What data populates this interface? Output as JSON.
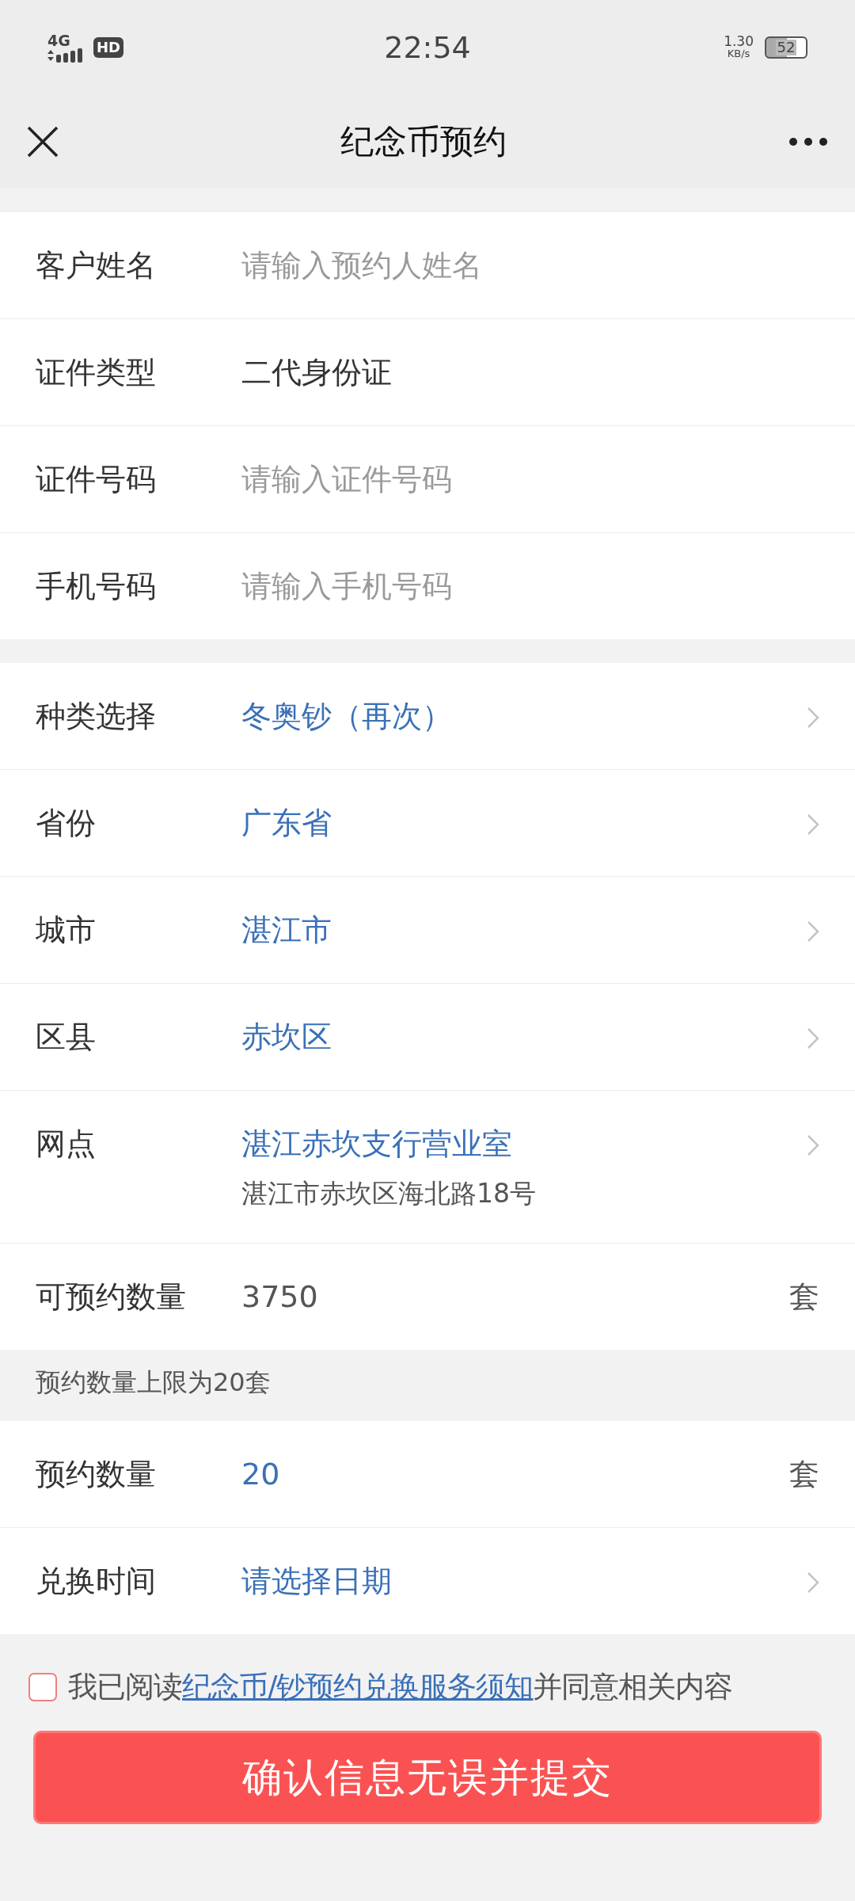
{
  "status_bar": {
    "network": "4G",
    "hd": "HD",
    "time": "22:54",
    "speed": "1.30",
    "speed_unit": "KB/s",
    "battery": "52"
  },
  "nav": {
    "title": "纪念币预约"
  },
  "sections": [
    {
      "rows": [
        {
          "kind": "input",
          "label": "客户姓名",
          "placeholder": "请输入预约人姓名"
        },
        {
          "kind": "text",
          "label": "证件类型",
          "value": "二代身份证"
        },
        {
          "kind": "input",
          "label": "证件号码",
          "placeholder": "请输入证件号码"
        },
        {
          "kind": "input",
          "label": "手机号码",
          "placeholder": "请输入手机号码"
        }
      ]
    },
    {
      "rows": [
        {
          "kind": "select",
          "label": "种类选择",
          "value": "冬奥钞（再次）"
        },
        {
          "kind": "select",
          "label": "省份",
          "value": "广东省"
        },
        {
          "kind": "select",
          "label": "城市",
          "value": "湛江市"
        },
        {
          "kind": "select",
          "label": "区县",
          "value": "赤坎区"
        },
        {
          "kind": "select",
          "label": "网点",
          "value": "湛江赤坎支行营业室",
          "detail": "湛江市赤坎区海北路18号"
        },
        {
          "kind": "stock",
          "label": "可预约数量",
          "value": "3750",
          "unit": "套"
        }
      ]
    },
    {
      "note": "预约数量上限为20套",
      "rows": [
        {
          "kind": "quantity",
          "label": "预约数量",
          "value": "20",
          "unit": "套"
        },
        {
          "kind": "select",
          "label": "兑换时间",
          "value": "请选择日期"
        }
      ]
    }
  ],
  "agreement": {
    "checked": false,
    "prefix": "我已阅读",
    "link": "纪念币/钞预约兑换服务须知",
    "suffix": "并同意相关内容"
  },
  "submit": {
    "label": "确认信息无误并提交"
  }
}
